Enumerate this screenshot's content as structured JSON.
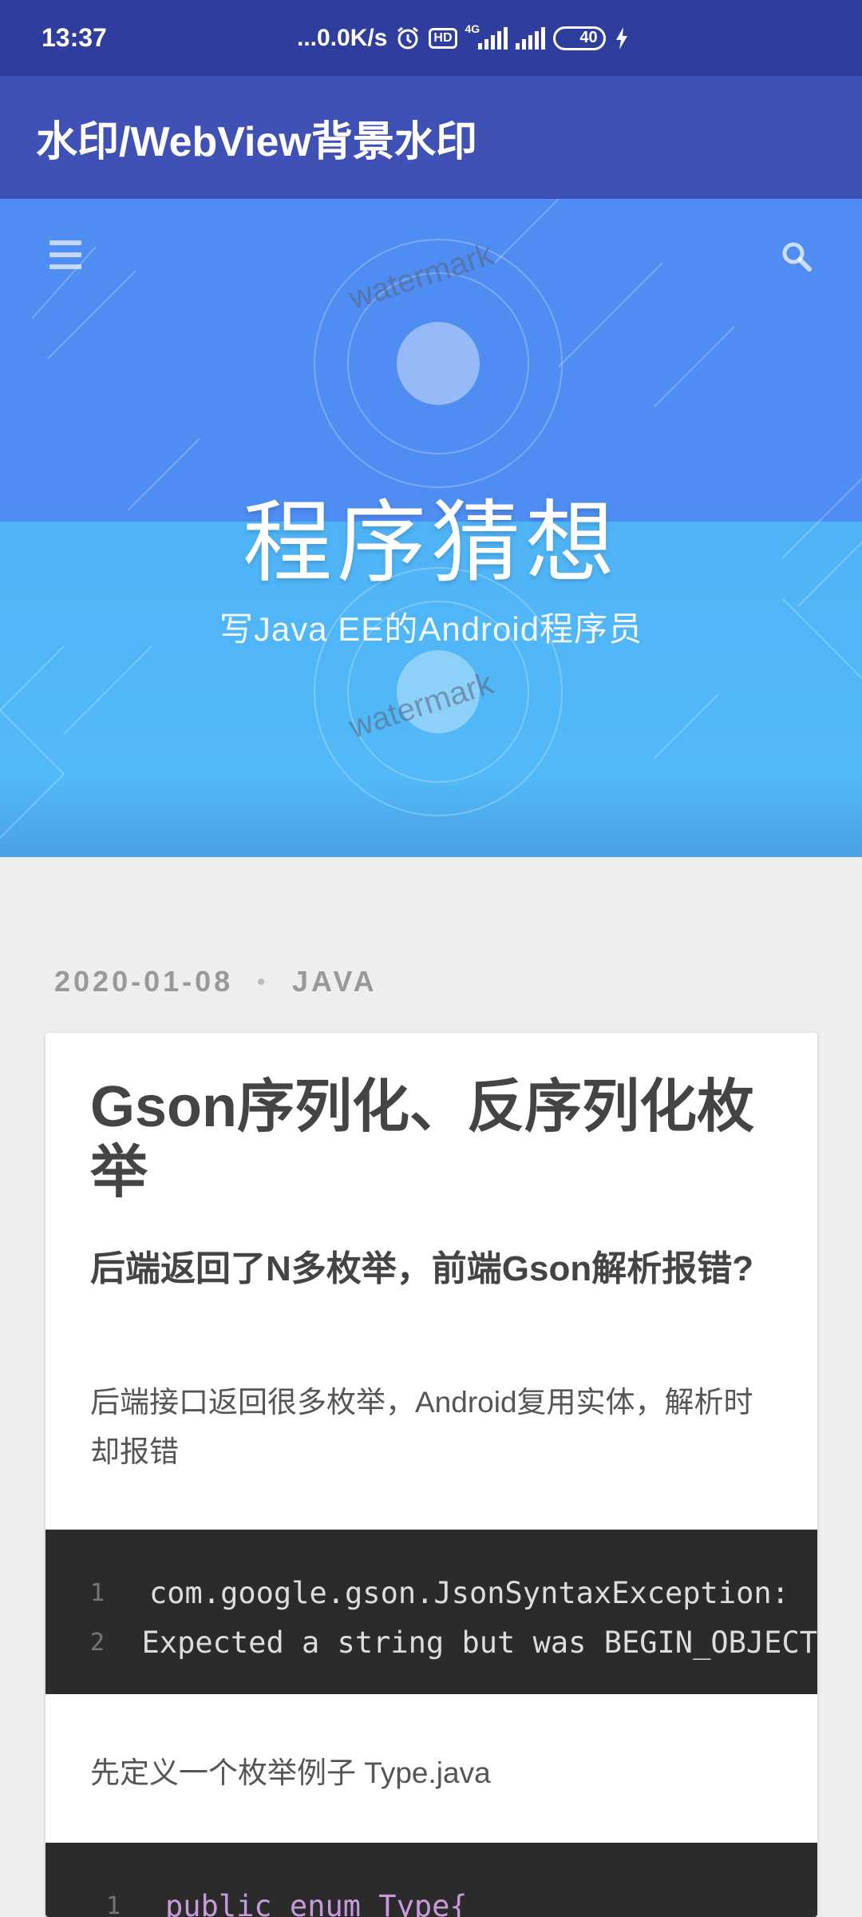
{
  "status_bar": {
    "time": "13:37",
    "network_speed": "...0.0K/s",
    "network_type": "4G",
    "hd_label": "HD",
    "battery_level": "40"
  },
  "app_bar": {
    "title": "水印/WebView背景水印"
  },
  "hero": {
    "title": "程序猜想",
    "subtitle": "写Java EE的Android程序员",
    "watermark_text": "watermark",
    "menu_icon": "menu-icon",
    "search_icon": "search-icon"
  },
  "post": {
    "date": "2020-01-08",
    "separator": "•",
    "category": "JAVA",
    "title": "Gson序列化、反序列化枚举",
    "heading": "后端返回了N多枚举，前端Gson解析报错?",
    "paragraph1": "后端接口返回很多枚举，Android复用实体，解析时却报错",
    "code1": [
      {
        "ln": "1",
        "text": "com.google.gson.JsonSyntaxException:"
      },
      {
        "ln": "2",
        "text": "Expected a string but was BEGIN_OBJECT"
      }
    ],
    "paragraph2": "先定义一个枚举例子 Type.java",
    "code2": [
      {
        "ln": "1",
        "text": "public enum Type{"
      }
    ]
  },
  "colors": {
    "status_bar": "#2f3e9e",
    "app_bar": "#3f51b5",
    "hero_top": "#4f8df2",
    "hero_bottom": "#4fb4f6",
    "code_bg": "#2b2b2b"
  }
}
